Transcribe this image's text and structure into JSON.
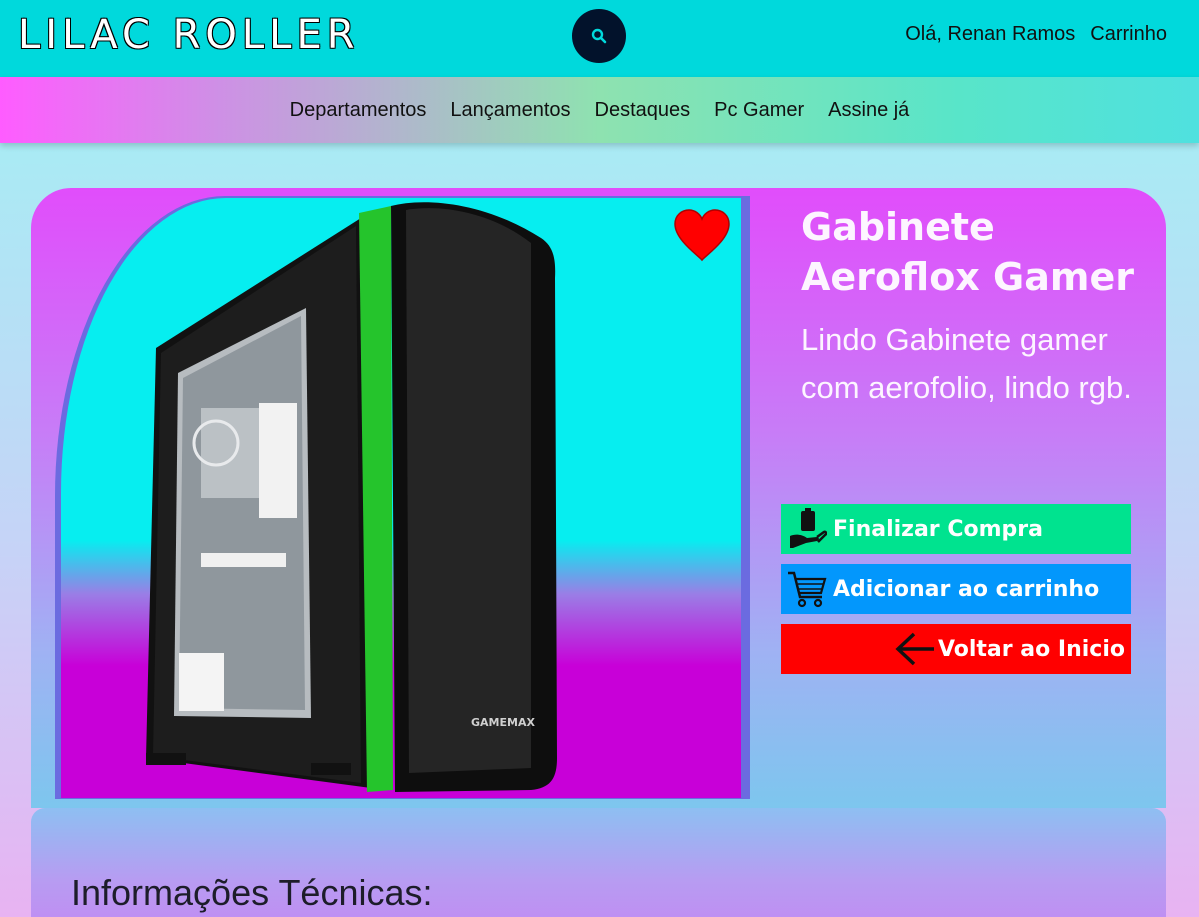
{
  "header": {
    "logo": "LILAC ROLLER",
    "search_icon": "search-icon",
    "greeting": "Olá, Renan Ramos",
    "cart_link": "Carrinho"
  },
  "nav": {
    "items": [
      "Departamentos",
      "Lançamentos",
      "Destaques",
      "Pc Gamer",
      "Assine já"
    ]
  },
  "product": {
    "title": "Gabinete Aeroflox Gamer",
    "description": "Lindo Gabinete gamer com aerofolio, lindo rgb.",
    "brand_mark": "GAMEMAX",
    "favorite_icon": "heart-icon",
    "actions": {
      "buy": "Finalizar Compra",
      "add_cart": "Adicionar ao carrinho",
      "back": "Voltar ao Inicio"
    }
  },
  "tech": {
    "title": "Informações Técnicas:"
  },
  "colors": {
    "header": "#00d9dc",
    "buy": "#00e38f",
    "cart": "#0397fc",
    "back": "#ff0000",
    "heart": "#ff0000"
  }
}
